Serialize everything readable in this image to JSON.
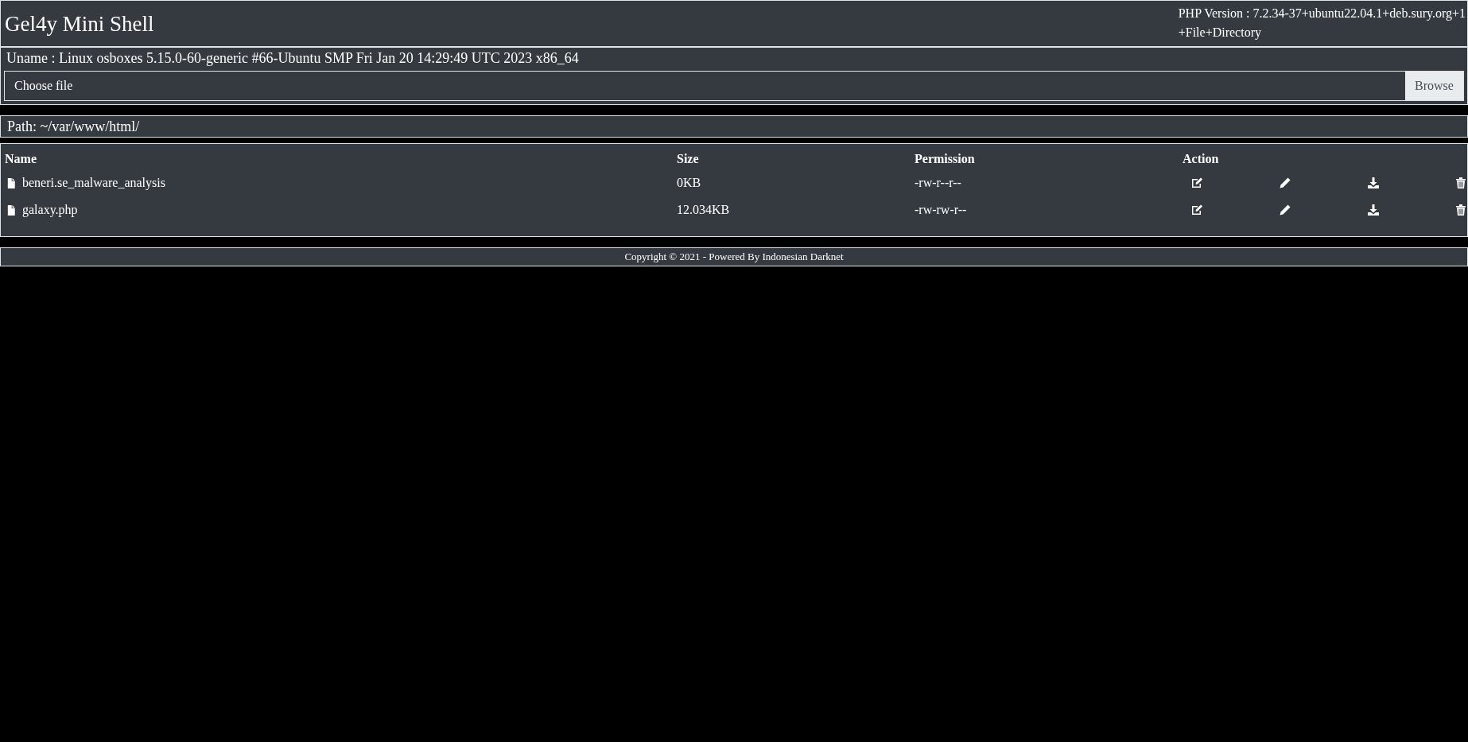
{
  "header": {
    "title": "Gel4y Mini Shell",
    "php_version": "PHP Version : 7.2.34-37+ubuntu22.04.1+deb.sury.org+1",
    "links": [
      "+File",
      "+Directory"
    ]
  },
  "uname": "Uname : Linux osboxes 5.15.0-60-generic #66-Ubuntu SMP Fri Jan 20 14:29:49 UTC 2023 x86_64",
  "upload": {
    "placeholder": "Choose file",
    "button": "Browse"
  },
  "path": "Path: ~/var/www/html/",
  "table": {
    "columns": [
      "Name",
      "Size",
      "Permission",
      "Action"
    ],
    "rows": [
      {
        "kind": "file",
        "name": "beneri.se_malware_analysis",
        "size": "0KB",
        "permission": "-rw-r--r--"
      },
      {
        "kind": "file",
        "name": "galaxy.php",
        "size": "12.034KB",
        "permission": "-rw-rw-r--"
      }
    ]
  },
  "footer": "Copyright © 2021 - Powered By Indonesian Darknet"
}
